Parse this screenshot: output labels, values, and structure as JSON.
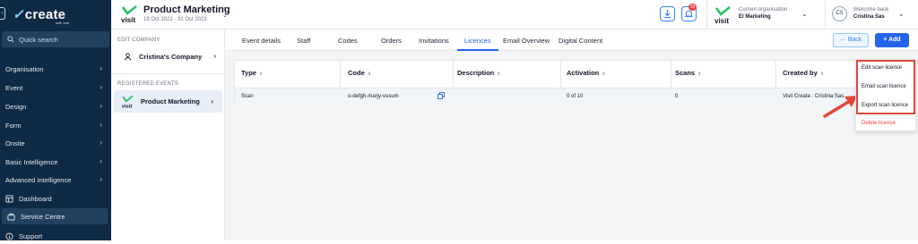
{
  "sidebar": {
    "brand": "create",
    "brand_sub": "with visit",
    "search_placeholder": "Quick search",
    "items": [
      {
        "label": "Organisation"
      },
      {
        "label": "Event"
      },
      {
        "label": "Design"
      },
      {
        "label": "Form"
      },
      {
        "label": "Onsite"
      },
      {
        "label": "Basic Intelligence"
      },
      {
        "label": "Advanced Intelligence"
      },
      {
        "label": "Dashboard"
      },
      {
        "label": "Service Centre"
      },
      {
        "label": "Support"
      }
    ]
  },
  "header": {
    "event_title": "Product Marketing",
    "event_dates": "19 Oct 2022 - 31 Oct 2023",
    "notification_count": "33",
    "org_label": "Current organisation",
    "org_name": "El Marketing",
    "avatar_initials": "CS",
    "welcome_label": "Welcome back",
    "user_name": "Cristina Sas",
    "logo_text": "visit"
  },
  "left_panel": {
    "edit_company_label": "EDIT COMPANY",
    "company_name": "Cristina's Company",
    "registered_events_label": "REGISTERED EVENTS",
    "event_name": "Product Marketing"
  },
  "tabs": [
    {
      "label": "Event details"
    },
    {
      "label": "Staff"
    },
    {
      "label": "Codes"
    },
    {
      "label": "Orders"
    },
    {
      "label": "Invitations"
    },
    {
      "label": "Licences"
    },
    {
      "label": "Email Overview"
    },
    {
      "label": "Digital Content"
    }
  ],
  "active_tab": "Licences",
  "buttons": {
    "back": "Back",
    "add": "Add"
  },
  "table": {
    "columns": [
      "Type",
      "Code",
      "Description",
      "Activation",
      "Scans",
      "Created by"
    ],
    "sort_glyph": "⇕",
    "rows": [
      {
        "type": "Scan",
        "code": "o-defgh-marjy-vusum",
        "description": "",
        "activation": "0 of 10",
        "scans": "0",
        "created_by": "Visit Create : Cristina Sas"
      }
    ]
  },
  "dropdown": {
    "items": [
      "Edit scan licence",
      "Email scan licence",
      "Export scan licence"
    ],
    "danger_item": "Delete licence"
  },
  "colors": {
    "sidebar_bg": "#0f2a44",
    "accent": "#2563eb",
    "danger": "#ef4444",
    "highlight": "#e0483b"
  }
}
